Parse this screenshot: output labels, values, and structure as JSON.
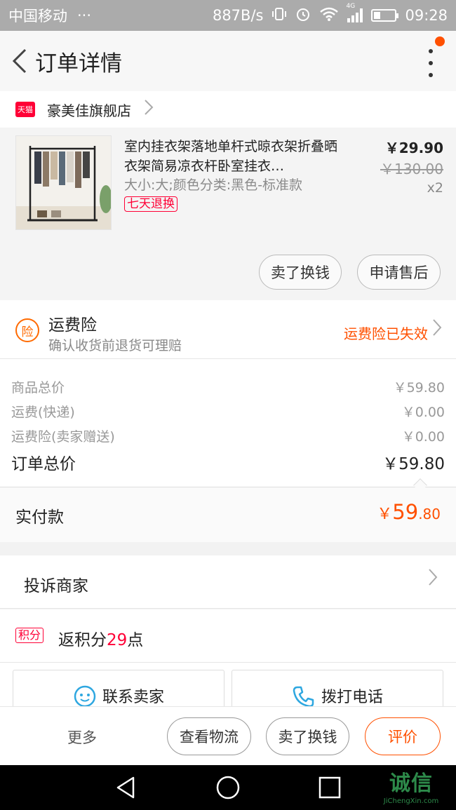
{
  "status_bar": {
    "carrier": "中国移动",
    "carrier_more": "···",
    "net_speed": "887B/s",
    "network_type": "4G",
    "time": "09:28",
    "icons": [
      "vibrate-icon",
      "alarm-icon",
      "wifi-icon",
      "signal-icon",
      "battery-icon"
    ]
  },
  "header": {
    "title": "订单详情",
    "back_icon": "chevron-left-icon",
    "more_icon": "more-vertical-icon",
    "notification_color": "#ff5000"
  },
  "shop": {
    "badge": "天猫",
    "name": "豪美佳旗舰店"
  },
  "product": {
    "title": "室内挂衣架落地单杆式晾衣架折叠晒衣架简易凉衣杆卧室挂衣…",
    "sku": "大小:大;颜色分类:黑色-标准款",
    "return_badge": "七天退换",
    "price": "￥29.90",
    "original_price": "￥130.00",
    "quantity": "x2",
    "actions": [
      "卖了换钱",
      "申请售后"
    ]
  },
  "insurance": {
    "icon_text": "险",
    "title": "运费险",
    "subtitle": "确认收货前退货可理赔",
    "status": "运费险已失效"
  },
  "summary": {
    "rows": [
      {
        "label": "商品总价",
        "value": "￥59.80"
      },
      {
        "label": "运费(快递)",
        "value": "￥0.00"
      },
      {
        "label": "运费险(卖家赠送)",
        "value": "￥0.00"
      }
    ],
    "total_label": "订单总价",
    "total_value": "￥59.80"
  },
  "paid": {
    "label": "实付款",
    "currency": "￥",
    "integer": "59",
    "decimal": ".80"
  },
  "complaint": {
    "label": "投诉商家"
  },
  "points": {
    "badge": "积分",
    "prefix": "返积分",
    "count": "29",
    "suffix": "点"
  },
  "contact": {
    "seller_label": "联系卖家",
    "phone_label": "拨打电话"
  },
  "bottom_bar": {
    "more": "更多",
    "logistics": "查看物流",
    "sell": "卖了换钱",
    "review": "评价"
  },
  "watermark": {
    "text": "诚信",
    "sub": "JiChengXin.com"
  },
  "colors": {
    "accent": "#ff5000",
    "tmall_red": "#ff0036",
    "status_bar": "#ababab"
  }
}
